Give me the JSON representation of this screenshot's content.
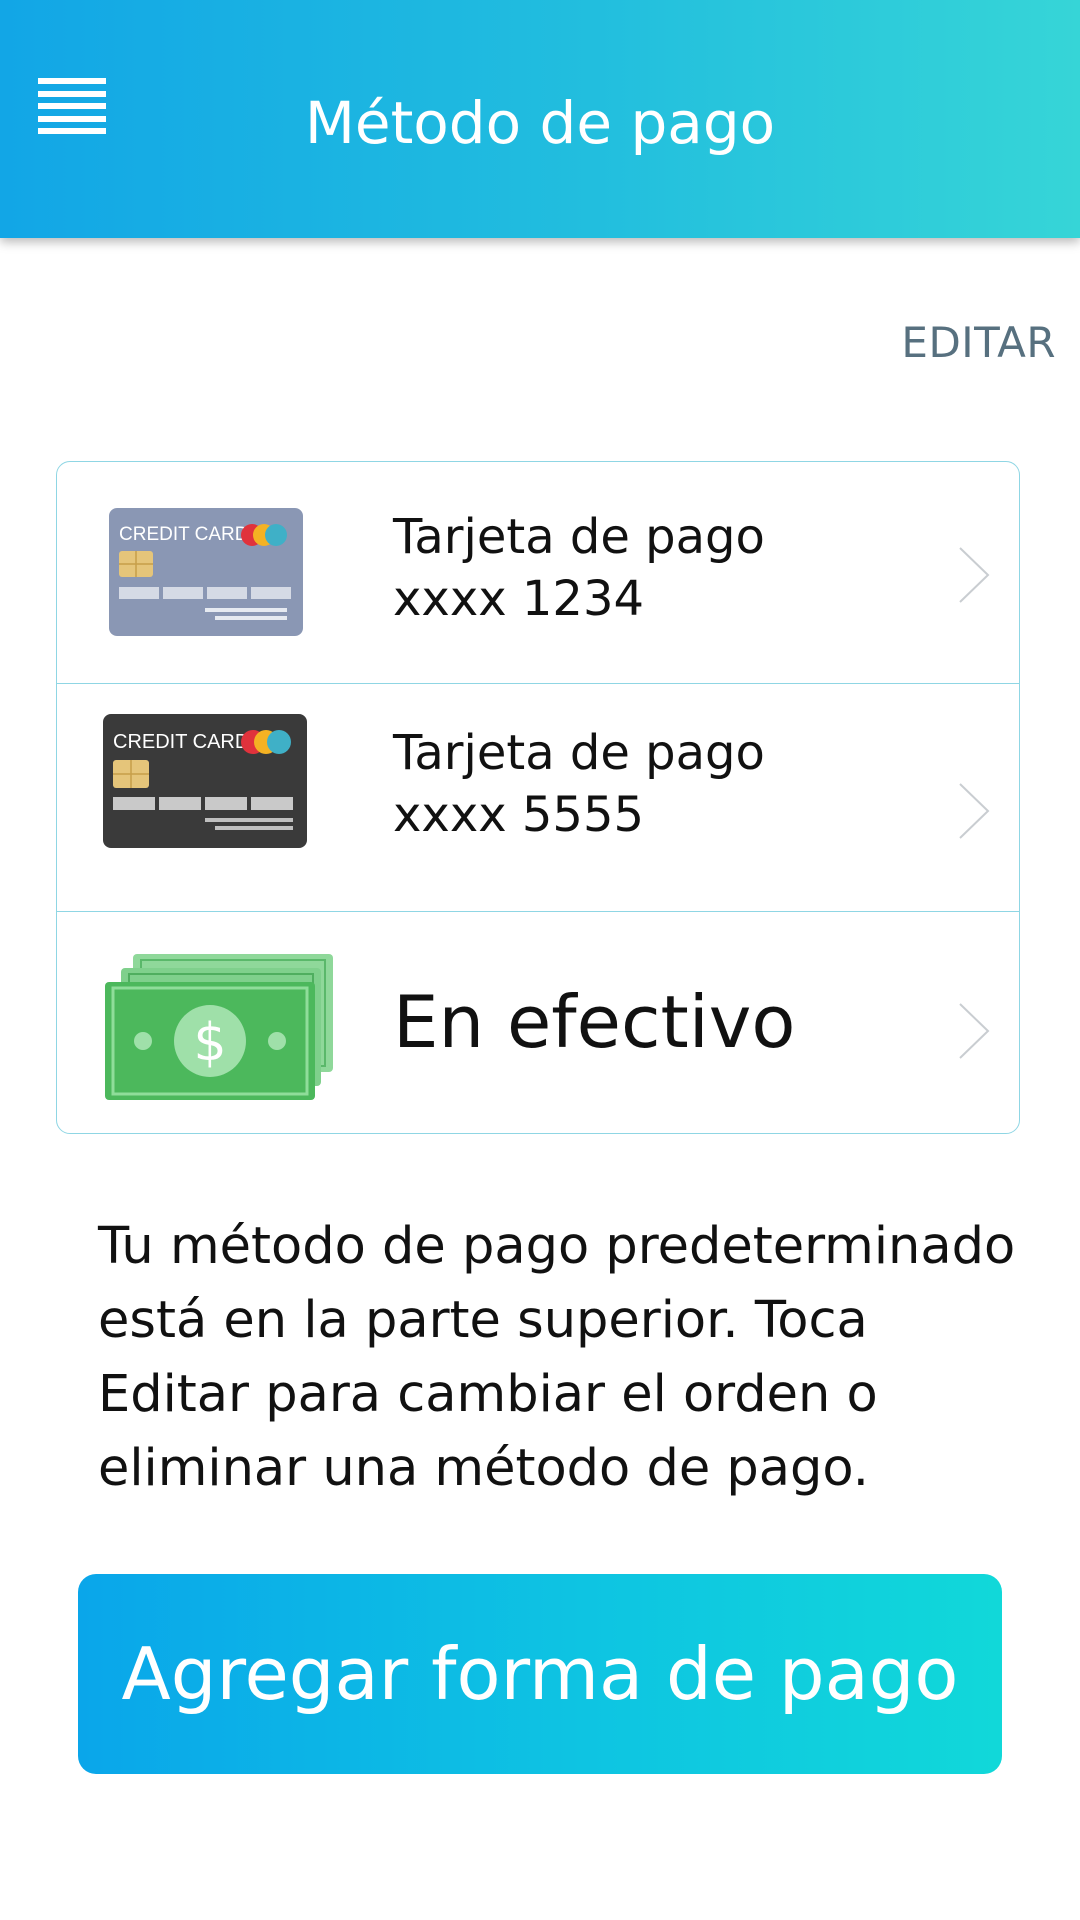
{
  "header": {
    "title": "Método de pago",
    "menu_icon": "hamburger-menu-icon"
  },
  "edit_label": "EDITAR",
  "payment_methods": [
    {
      "type": "card",
      "card_text": "CREDIT CARD",
      "label": "Tarjeta de pago",
      "number": "xxxx 1234",
      "card_color": "#8a97b4"
    },
    {
      "type": "card",
      "card_text": "CREDIT CARD",
      "label": "Tarjeta de pago",
      "number": "xxxx 5555",
      "card_color": "#3a3a3a"
    },
    {
      "type": "cash",
      "label": "En efectivo",
      "icon": "cash-bills-icon"
    }
  ],
  "help_text": "Tu método de pago predeterminado está en la parte superior. Toca Editar para cambiar el orden o eliminar una método de pago.",
  "add_button_label": "Agregar forma de pago",
  "colors": {
    "header_gradient_start": "#12a6e6",
    "header_gradient_end": "#36d5d7",
    "button_gradient_start": "#0aa6ea",
    "button_gradient_end": "#11d8d9",
    "divider": "#8fd6e4"
  }
}
